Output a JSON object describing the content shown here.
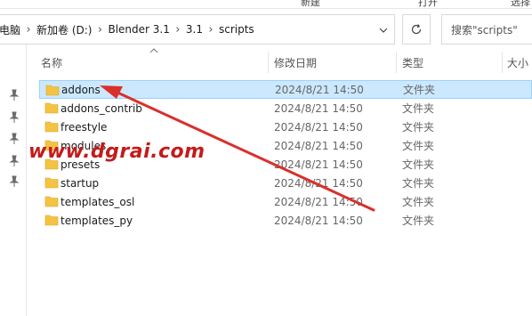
{
  "ribbon": {
    "new_label": "新建",
    "open_label": "打开",
    "select_label": "选择"
  },
  "breadcrumb": [
    "电脑",
    "新加卷 (D:)",
    "Blender 3.1",
    "3.1",
    "scripts"
  ],
  "search": {
    "placeholder": "搜索\"scripts\""
  },
  "columns": {
    "name": "名称",
    "modified": "修改日期",
    "type": "类型",
    "size": "大小"
  },
  "files": [
    {
      "name": "addons",
      "date": "2024/8/21 14:50",
      "type": "文件夹",
      "selected": true
    },
    {
      "name": "addons_contrib",
      "date": "2024/8/21 14:50",
      "type": "文件夹"
    },
    {
      "name": "freestyle",
      "date": "2024/8/21 14:50",
      "type": "文件夹"
    },
    {
      "name": "modules",
      "date": "2024/8/21 14:50",
      "type": "文件夹"
    },
    {
      "name": "presets",
      "date": "2024/8/21 14:50",
      "type": "文件夹"
    },
    {
      "name": "startup",
      "date": "2024/8/21 14:50",
      "type": "文件夹"
    },
    {
      "name": "templates_osl",
      "date": "2024/8/21 14:50",
      "type": "文件夹"
    },
    {
      "name": "templates_py",
      "date": "2024/8/21 14:50",
      "type": "文件夹"
    }
  ],
  "watermark": {
    "text": "www.dgrai.com"
  },
  "colors": {
    "selection_bg": "#cce8ff",
    "folder": "#f5c342",
    "annotation_red": "#d9302c"
  }
}
